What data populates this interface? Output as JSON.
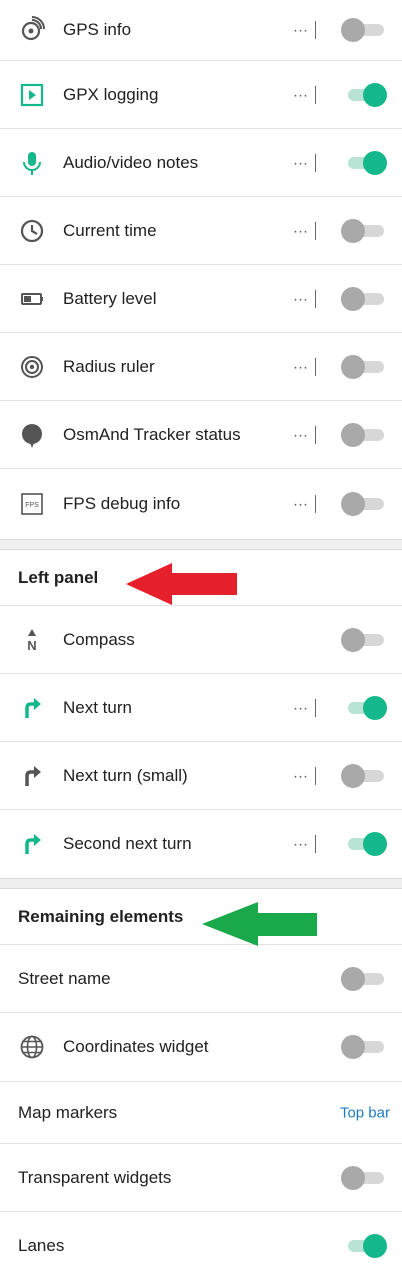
{
  "top_section": {
    "items": [
      {
        "label": "GPS info",
        "icon": "gps-info-icon",
        "on": false
      },
      {
        "label": "GPX logging",
        "icon": "gpx-logging-icon",
        "on": true
      },
      {
        "label": "Audio/video notes",
        "icon": "microphone-icon",
        "on": true
      },
      {
        "label": "Current time",
        "icon": "clock-icon",
        "on": false
      },
      {
        "label": "Battery level",
        "icon": "battery-icon",
        "on": false
      },
      {
        "label": "Radius ruler",
        "icon": "radius-ruler-icon",
        "on": false
      },
      {
        "label": "OsmAnd Tracker status",
        "icon": "tracker-status-icon",
        "on": false
      },
      {
        "label": "FPS debug info",
        "icon": "fps-icon",
        "on": false
      }
    ],
    "more_label": "···"
  },
  "left_panel": {
    "title": "Left panel",
    "items": [
      {
        "label": "Compass",
        "icon": "compass-icon",
        "on": false
      },
      {
        "label": "Next turn",
        "icon": "turn-right-icon",
        "on": true
      },
      {
        "label": "Next turn (small)",
        "icon": "turn-right-small-icon",
        "on": false
      },
      {
        "label": "Second next turn",
        "icon": "turn-right-icon",
        "on": true
      }
    ],
    "compass_letter": "N"
  },
  "remaining": {
    "title": "Remaining elements",
    "items": [
      {
        "label": "Street name",
        "on": false
      },
      {
        "label": "Coordinates widget",
        "icon": "globe-icon",
        "on": false
      },
      {
        "label": "Map markers",
        "value": "Top bar"
      },
      {
        "label": "Transparent widgets",
        "on": false
      },
      {
        "label": "Lanes",
        "on": true
      }
    ]
  },
  "fps_icon_text": "FPS",
  "colors": {
    "accent": "#15b88a",
    "link": "#1f7bc1",
    "red_arrow": "#e5202b",
    "green_arrow": "#19a84a"
  }
}
